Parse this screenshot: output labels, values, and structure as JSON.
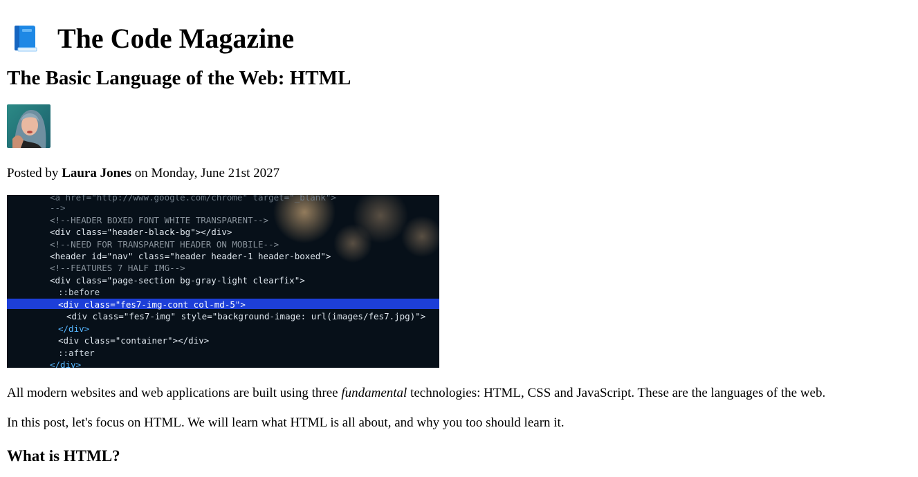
{
  "header": {
    "site_title": "The Code Magazine",
    "logo_icon": "blue-book-icon"
  },
  "article": {
    "title": "The Basic Language of the Web: HTML",
    "avatar_icon": "author-avatar",
    "byline": {
      "prefix": "Posted by ",
      "author": "Laura Jones",
      "suffix": " on Monday, June 21st 2027"
    },
    "hero_alt": "HTML code",
    "hero_code": [
      "  <a href=\"http://www.google.com/chrome\" target=\"_blank\">",
      "-->",
      "<!--HEADER BOXED FONT WHITE TRANSPARENT-->",
      "<div class=\"header-black-bg\"></div>",
      "<!--NEED FOR TRANSPARENT HEADER ON MOBILE-->",
      "<header id=\"nav\" class=\"header header-1 header-boxed\">",
      "<!--FEATURES 7 HALF IMG-->",
      "<div class=\"page-section bg-gray-light clearfix\">",
      "::before",
      "<div class=\"fes7-img-cont col-md-5\">",
      "<div class=\"fes7-img\" style=\"background-image: url(images/fes7.jpg)\">",
      "</div>",
      "<div class=\"container\"></div>",
      "::after",
      "</div>"
    ],
    "paragraph1": {
      "before": "All modern websites and web applications are built using three ",
      "emphasis": "fundamental",
      "after": " technologies: HTML, CSS and JavaScript. These are the languages of the web."
    },
    "paragraph2": "In this post, let's focus on HTML. We will learn what HTML is all about, and why you too should learn it.",
    "section_heading": "What is HTML?"
  }
}
